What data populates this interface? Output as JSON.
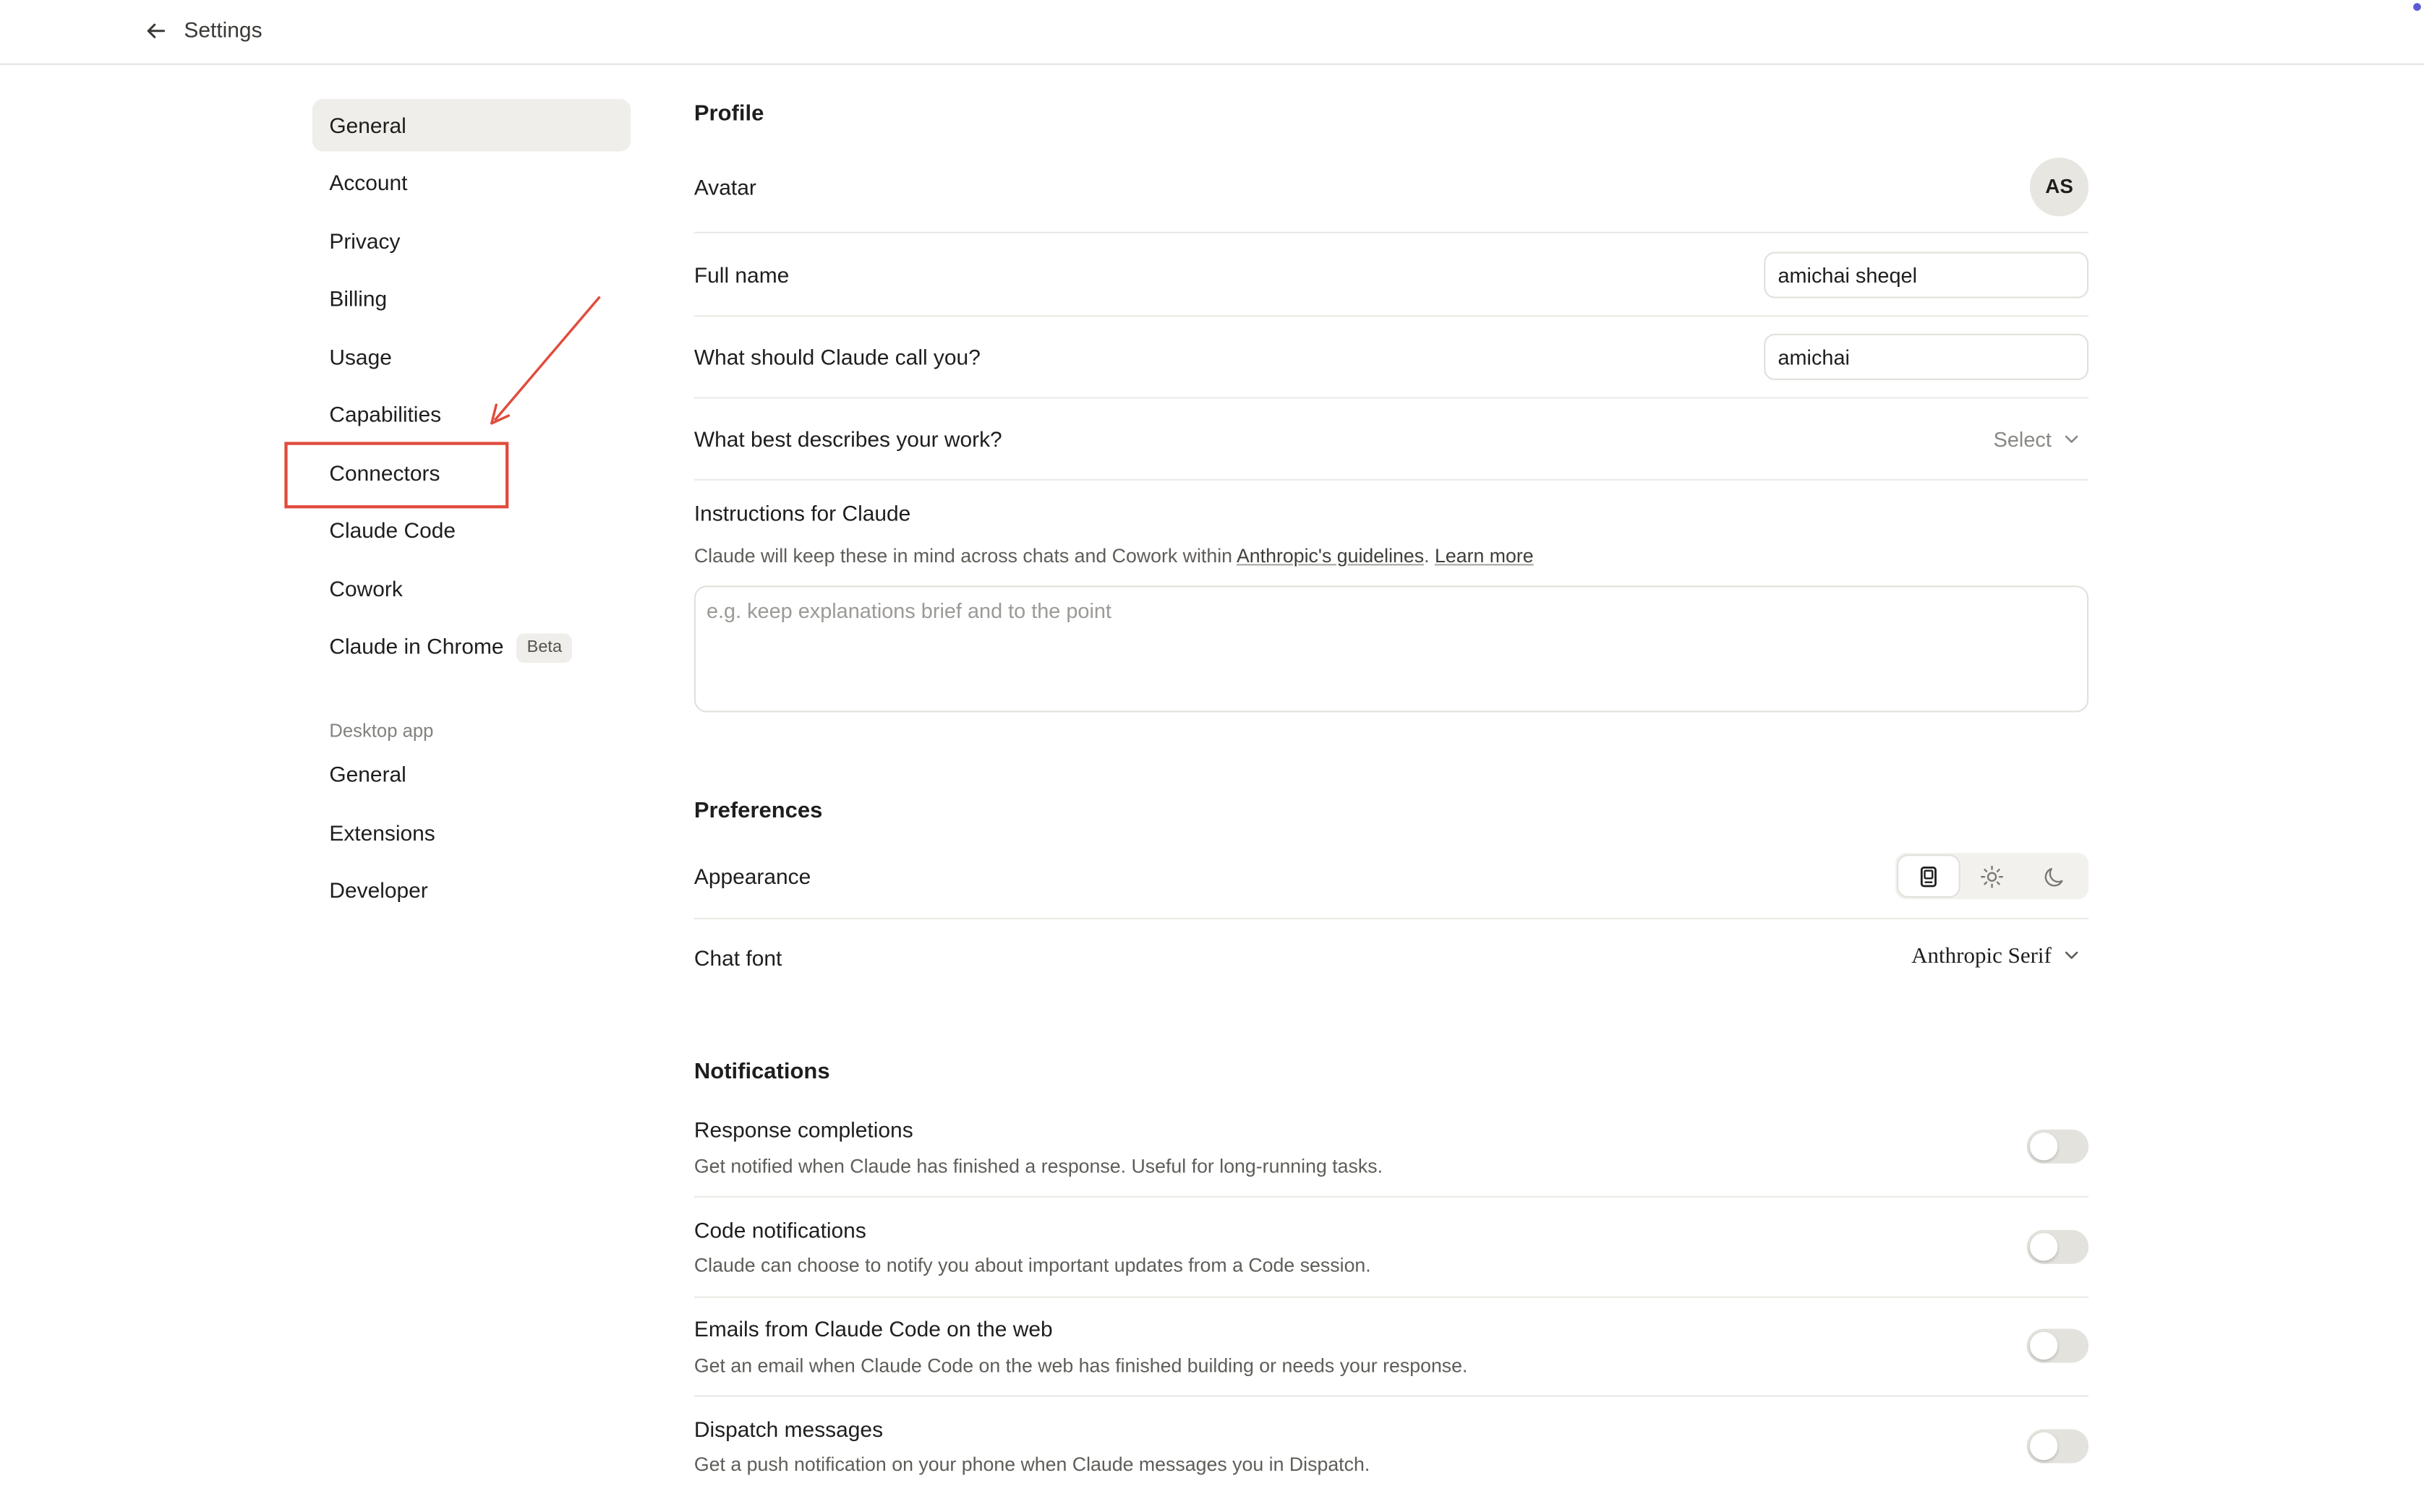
{
  "header": {
    "title": "Settings",
    "back_icon": "arrow-left-icon"
  },
  "sidebar": {
    "items": [
      {
        "label": "General",
        "active": true
      },
      {
        "label": "Account"
      },
      {
        "label": "Privacy"
      },
      {
        "label": "Billing"
      },
      {
        "label": "Usage"
      },
      {
        "label": "Capabilities"
      },
      {
        "label": "Connectors"
      },
      {
        "label": "Claude Code"
      },
      {
        "label": "Cowork"
      },
      {
        "label": "Claude in Chrome",
        "badge": "Beta"
      }
    ],
    "desktop_section_label": "Desktop app",
    "desktop_items": [
      {
        "label": "General"
      },
      {
        "label": "Extensions"
      },
      {
        "label": "Developer"
      }
    ]
  },
  "profile": {
    "section_title": "Profile",
    "avatar_label": "Avatar",
    "avatar_initials": "AS",
    "full_name_label": "Full name",
    "full_name_value": "amichai sheqel",
    "call_you_label": "What should Claude call you?",
    "call_you_value": "amichai",
    "work_label": "What best describes your work?",
    "work_select": "Select",
    "instructions_label": "Instructions for Claude",
    "instructions_desc_prefix": "Claude will keep these in mind across chats and Cowork within ",
    "instructions_link_guidelines": "Anthropic's guidelines",
    "instructions_desc_sep": ". ",
    "instructions_link_learn": "Learn more",
    "instructions_placeholder": "e.g. keep explanations brief and to the point"
  },
  "preferences": {
    "section_title": "Preferences",
    "appearance_label": "Appearance",
    "appearance_options": [
      "system-icon",
      "sun-icon",
      "moon-icon"
    ],
    "appearance_selected": "system-icon",
    "chat_font_label": "Chat font",
    "chat_font_value": "Anthropic Serif"
  },
  "notifications": {
    "section_title": "Notifications",
    "items": [
      {
        "title": "Response completions",
        "desc": "Get notified when Claude has finished a response. Useful for long-running tasks.",
        "enabled": false
      },
      {
        "title": "Code notifications",
        "desc": "Claude can choose to notify you about important updates from a Code session.",
        "enabled": false
      },
      {
        "title": "Emails from Claude Code on the web",
        "desc": "Get an email when Claude Code on the web has finished building or needs your response.",
        "enabled": false
      },
      {
        "title": "Dispatch messages",
        "desc": "Get a push notification on your phone when Claude messages you in Dispatch.",
        "enabled": false
      }
    ]
  },
  "colors": {
    "annotation": "#e04b3c",
    "active_nav_bg": "#efeeea"
  }
}
